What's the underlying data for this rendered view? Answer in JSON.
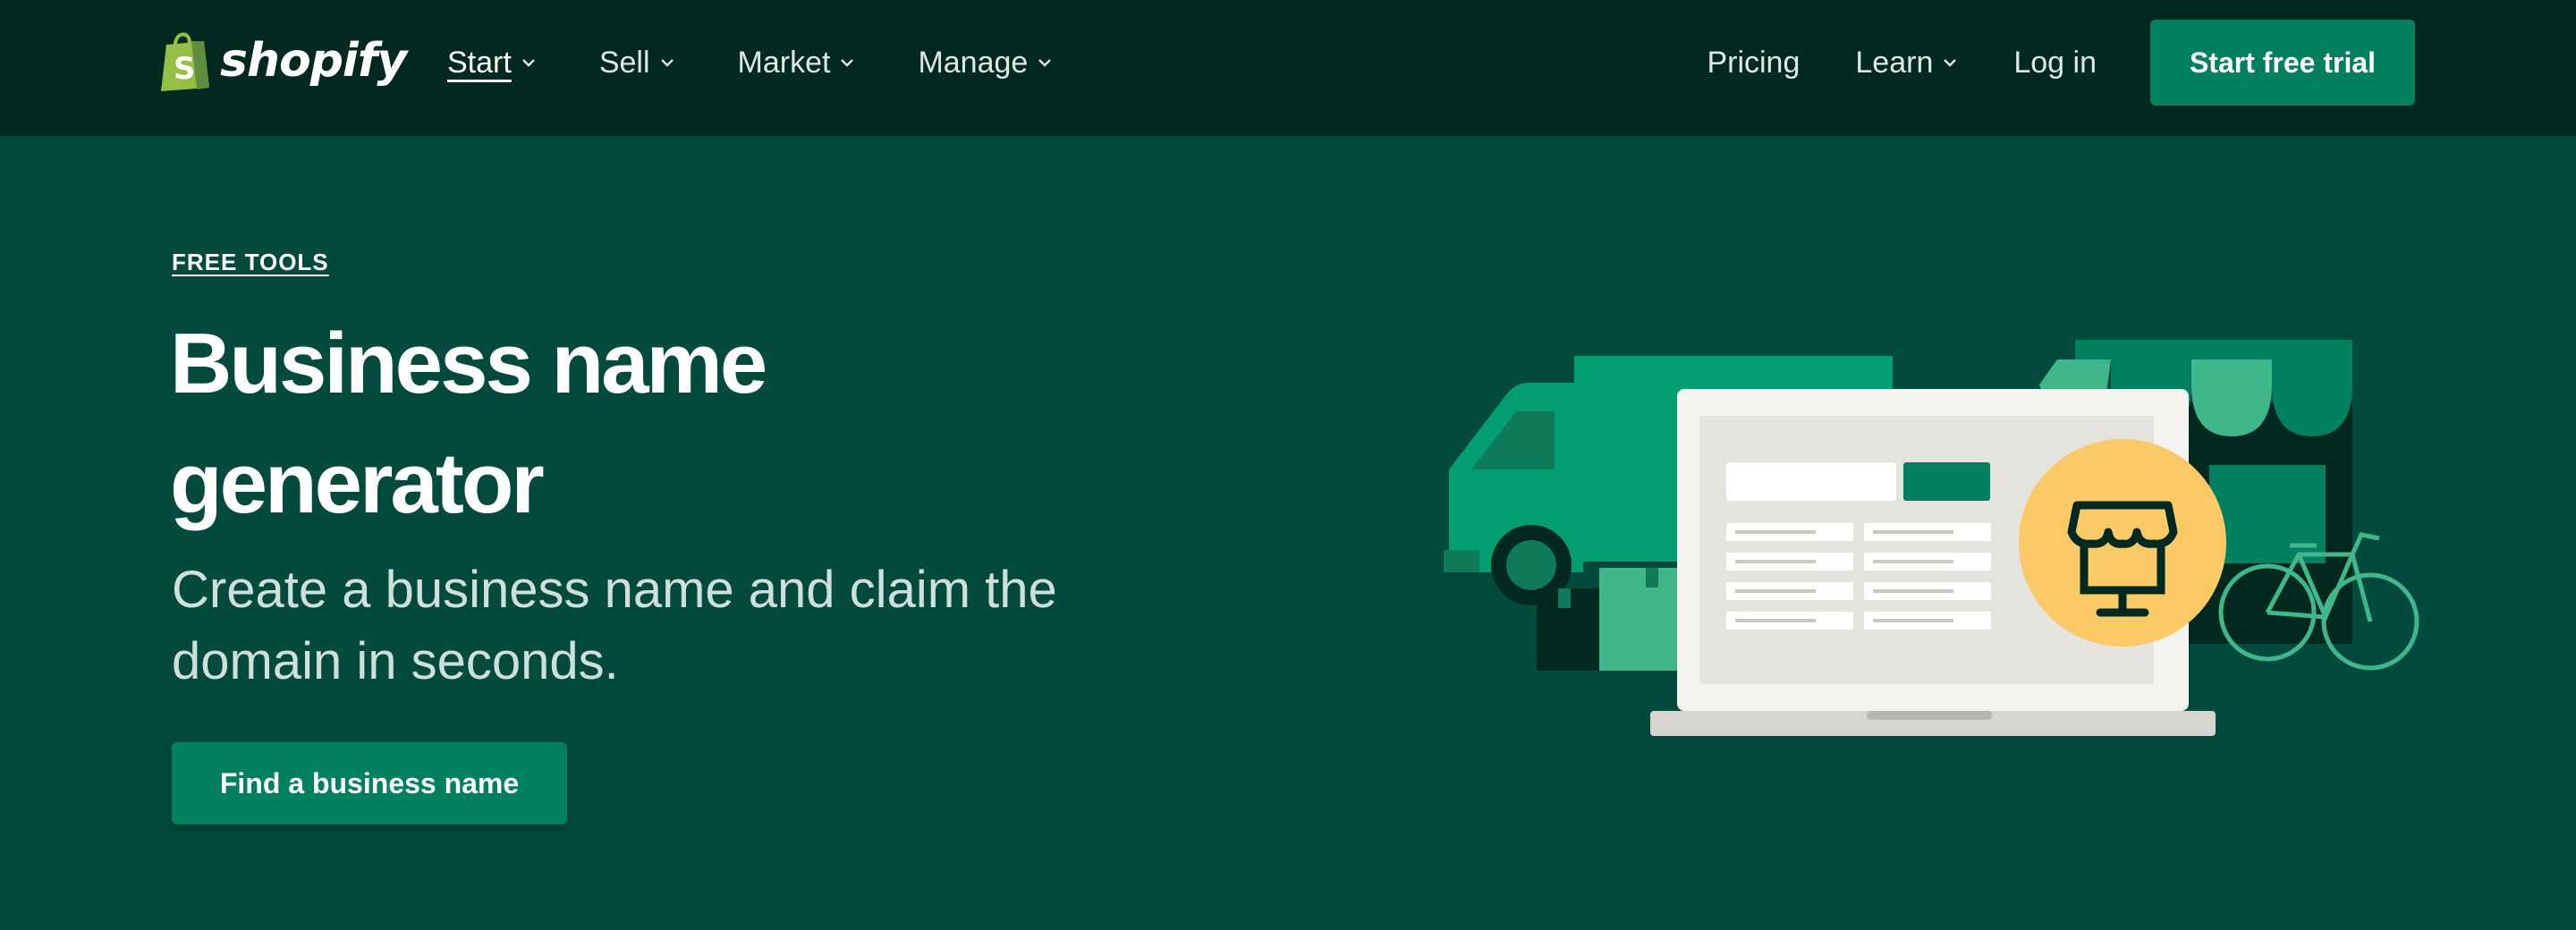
{
  "brand": {
    "name": "shopify"
  },
  "nav": {
    "left": [
      {
        "label": "Start",
        "active": true
      },
      {
        "label": "Sell"
      },
      {
        "label": "Market"
      },
      {
        "label": "Manage"
      }
    ],
    "pricing": "Pricing",
    "learn": "Learn",
    "login": "Log in",
    "trial": "Start free trial"
  },
  "hero": {
    "eyebrow": "FREE TOOLS",
    "title": "Business name generator",
    "subtitle": "Create a business name and claim the domain in seconds.",
    "cta": "Find a business name"
  },
  "colors": {
    "nav_bg": "#01291f",
    "hero_bg": "#024a3e",
    "accent": "#008060",
    "badge": "#fbc966"
  }
}
